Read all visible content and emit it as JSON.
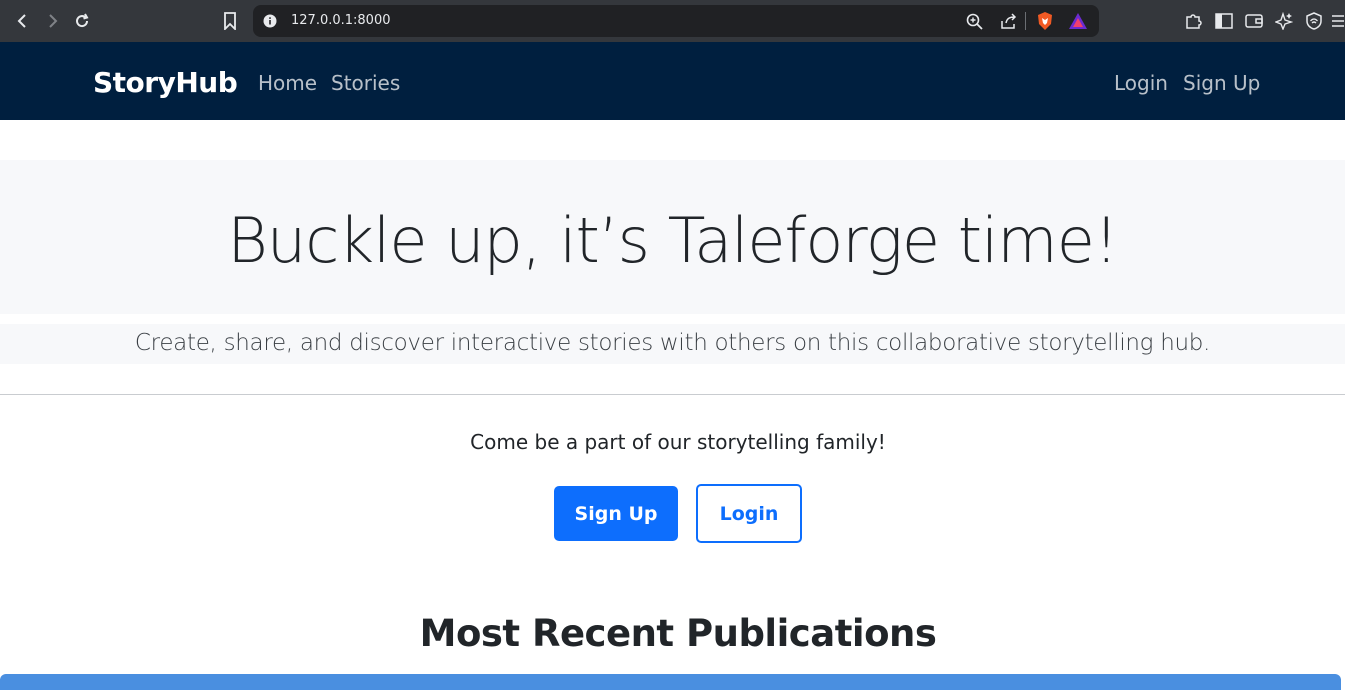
{
  "browser": {
    "url": "127.0.0.1:8000",
    "icons": [
      "back-icon",
      "forward-icon",
      "reload-icon",
      "bookmark-icon",
      "site-info-icon",
      "zoom-icon",
      "share-icon",
      "brave-shield-icon",
      "rewards-icon",
      "extensions-icon",
      "sidebar-icon",
      "wallet-icon",
      "leo-ai-icon",
      "vpn-icon",
      "menu-icon"
    ]
  },
  "navbar": {
    "brand": "StoryHub",
    "links": {
      "home": "Home",
      "stories": "Stories",
      "login": "Login",
      "signup": "Sign Up"
    },
    "background": "#001f3f"
  },
  "hero": {
    "title": "Buckle up, it’s Taleforge time!",
    "lead": "Create, share, and discover interactive stories with others on this collaborative storytelling hub."
  },
  "cta": {
    "text": "Come be a part of our storytelling family!",
    "signup_label": "Sign Up",
    "login_label": "Login",
    "accent": "#0d6efd"
  },
  "publications": {
    "heading": "Most Recent Publications"
  }
}
